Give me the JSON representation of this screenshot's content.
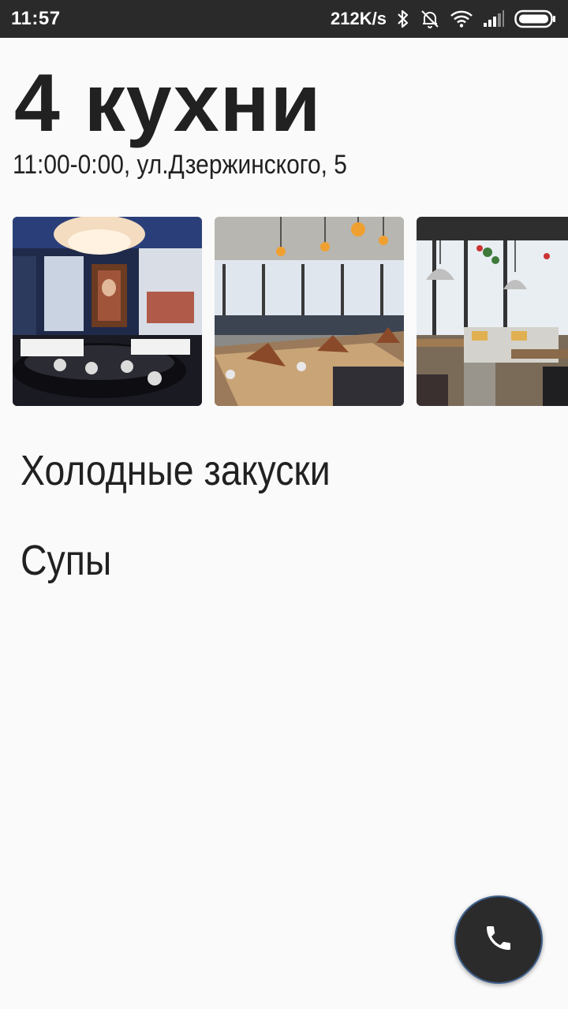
{
  "status_bar": {
    "time": "11:57",
    "network_speed": "212K/s",
    "icons": [
      "bluetooth-icon",
      "alarm-off-icon",
      "wifi-icon",
      "signal-icon",
      "battery-icon"
    ]
  },
  "restaurant": {
    "title": "4 кухни",
    "info": "11:00-0:00, ул.Дзержинского, 5"
  },
  "gallery": {
    "photos": [
      "restaurant-interior-photo-1",
      "restaurant-interior-photo-2",
      "restaurant-interior-photo-3"
    ]
  },
  "menu": {
    "categories": [
      "Холодные закуски",
      "Супы"
    ]
  },
  "fab": {
    "icon": "phone-icon",
    "color": "#2b2b2b"
  }
}
